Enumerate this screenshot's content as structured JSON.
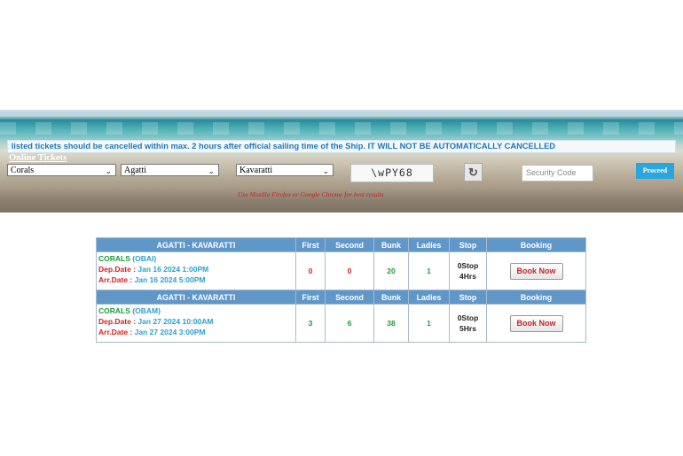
{
  "banner": {
    "notice": ": listed tickets should be cancelled within max. 2 hours after official sailing time of the Ship. IT WILL NOT BE AUTOMATICALLY CANCELLED",
    "online_tickets": "Online Tickets",
    "ship_select": "Corals",
    "from_select": "Agatti",
    "to_select": "Kavaratti",
    "captcha": "\\wPY68",
    "refresh_glyph": "↻",
    "security_placeholder": "Security Code",
    "proceed": "Proceed",
    "browser_hint": "Use Mozilla Firefox or Google Chrome for best results"
  },
  "table": {
    "columns": [
      "First",
      "Second",
      "Bunk",
      "Ladies",
      "Stop",
      "Booking"
    ],
    "rows": [
      {
        "route": "AGATTI - KAVARATTI",
        "ship": "CORALS",
        "code": "(OBAI)",
        "dep_label": "Dep.Date : ",
        "dep": "Jan 16 2024 1:00PM",
        "arr_label": "Arr.Date : ",
        "arr": "Jan 16 2024 5:00PM",
        "first": "0",
        "second": "0",
        "bunk": "20",
        "ladies": "1",
        "stop": "0Stop",
        "duration": "4Hrs",
        "book": "Book Now"
      },
      {
        "route": "AGATTI - KAVARATTI",
        "ship": "CORALS",
        "code": "(OBAM)",
        "dep_label": "Dep.Date : ",
        "dep": "Jan 27 2024 10:00AM",
        "arr_label": "Arr.Date : ",
        "arr": "Jan 27 2024 3:00PM",
        "first": "3",
        "second": "6",
        "bunk": "38",
        "ladies": "1",
        "stop": "0Stop",
        "duration": "5Hrs",
        "book": "Book Now"
      }
    ]
  }
}
